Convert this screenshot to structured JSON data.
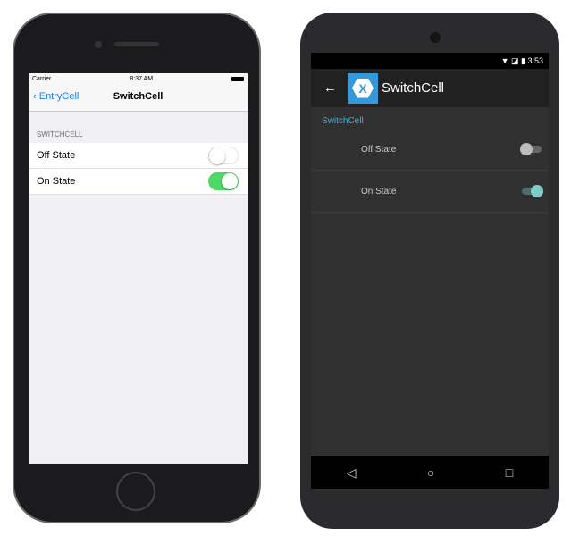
{
  "ios": {
    "carrier": "Carrier",
    "time": "8:37 AM",
    "back_label": "EntryCell",
    "title": "SwitchCell",
    "section": "SWITCHCELL",
    "cells": [
      {
        "label": "Off State",
        "on": false
      },
      {
        "label": "On State",
        "on": true
      }
    ],
    "accent": "#157efb",
    "switch_on_color": "#4cd964"
  },
  "android": {
    "time": "3:53",
    "title": "SwitchCell",
    "logo": "X",
    "section": "SwitchCell",
    "cells": [
      {
        "label": "Off State",
        "on": false
      },
      {
        "label": "On State",
        "on": true
      }
    ],
    "accent": "#33b5e5",
    "switch_on_color": "#80cbc4",
    "nav_icons": [
      "back-triangle-icon",
      "home-circle-icon",
      "recents-square-icon"
    ]
  }
}
